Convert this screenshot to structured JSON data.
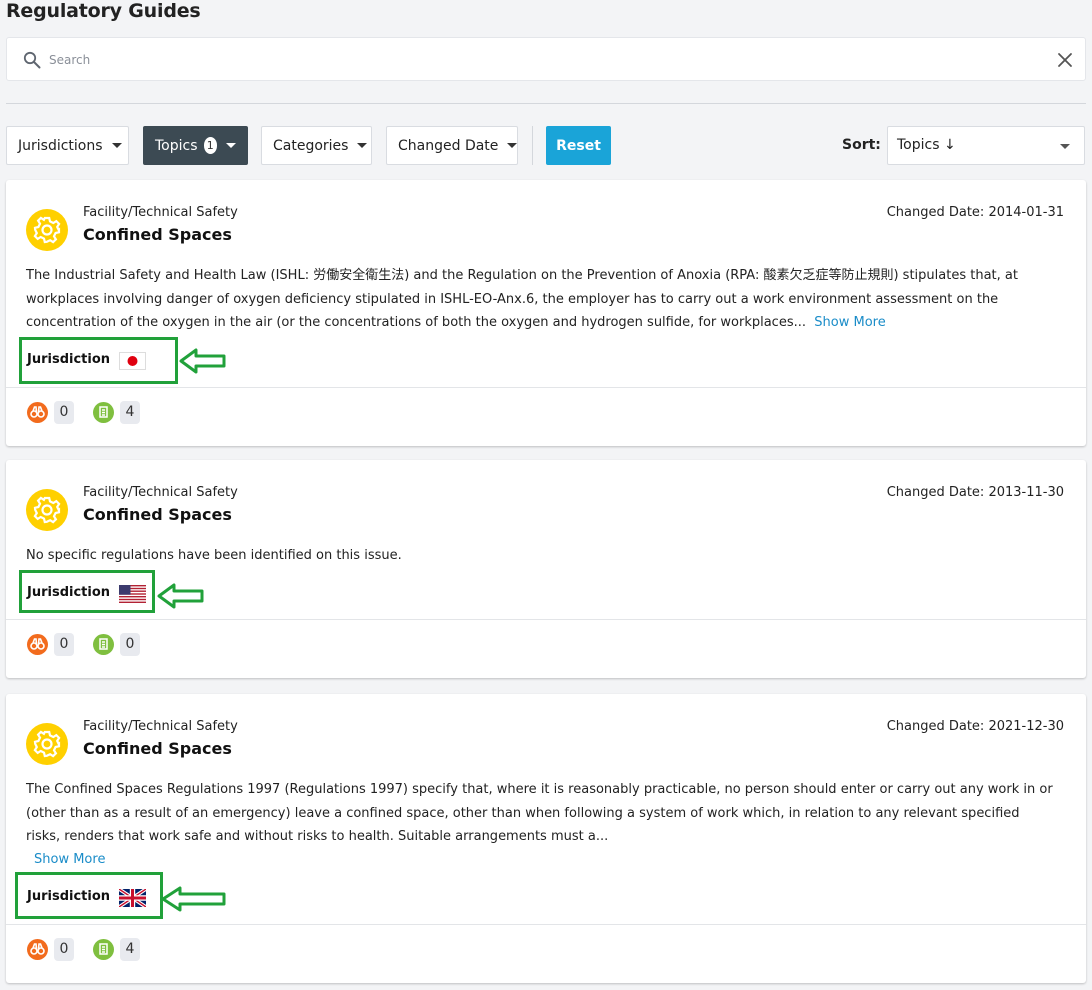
{
  "page_title": "Regulatory Guides",
  "search": {
    "placeholder": "Search",
    "value": ""
  },
  "filters": {
    "jurisdictions": "Jurisdictions",
    "topics": "Topics",
    "topics_count": "1",
    "categories": "Categories",
    "changed_date": "Changed Date",
    "reset": "Reset"
  },
  "sort": {
    "label": "Sort:",
    "value": "Topics ↓"
  },
  "colors": {
    "accent": "#1aa4d8",
    "dark_filter": "#3c4a53",
    "highlight": "#21a13a",
    "topic_icon": "#ffd000",
    "stat_orange": "#f26b1d",
    "stat_green": "#7fbf3f"
  },
  "cards": [
    {
      "category": "Facility/Technical Safety",
      "title": "Confined Spaces",
      "changed_date": "Changed Date: 2014-01-31",
      "description": "The Industrial Safety and Health Law (ISHL: 労働安全衛生法) and the Regulation on the Prevention of Anoxia (RPA: 酸素欠乏症等防止規則) stipulates that, at workplaces involving danger of oxygen deficiency stipulated in ISHL-EO-Anx.6, the employer has to carry out a work environment assessment on the concentration of the oxygen in the air (or the concentrations of both the oxygen and hydrogen sulfide, for workplaces...",
      "show_more": "Show More",
      "jurisdiction_label": "Jurisdiction",
      "flag": "japan-flag-icon",
      "count_a": "0",
      "count_b": "4"
    },
    {
      "category": "Facility/Technical Safety",
      "title": "Confined Spaces",
      "changed_date": "Changed Date: 2013-11-30",
      "description": "No specific regulations have been identified on this issue.",
      "jurisdiction_label": "Jurisdiction",
      "flag": "usa-flag-icon",
      "count_a": "0",
      "count_b": "0"
    },
    {
      "category": "Facility/Technical Safety",
      "title": "Confined Spaces",
      "changed_date": "Changed Date: 2021-12-30",
      "description": "The Confined Spaces Regulations 1997 (Regulations 1997) specify that, where it is reasonably practicable, no person should enter or carry out any work in or (other than as a result of an emergency) leave a confined space, other than when following a system of work which, in relation to any relevant specified risks, renders that work safe and without risks to health. Suitable arrangements must a...",
      "show_more": "Show More",
      "jurisdiction_label": "Jurisdiction",
      "flag": "uk-flag-icon",
      "count_a": "0",
      "count_b": "4"
    }
  ]
}
